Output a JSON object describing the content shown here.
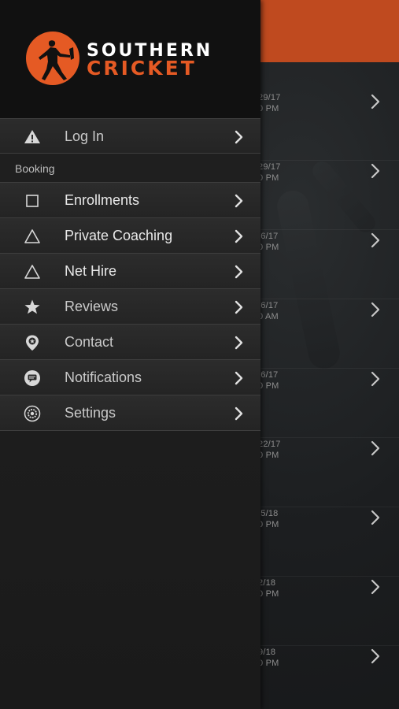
{
  "app": {
    "logo_line1": "SOUTHERN",
    "logo_line2": "CRICKET",
    "colors": {
      "accent": "#bf4a1f",
      "logo_orange": "#e55a24",
      "drawer_bg": "#242424",
      "header_bg": "#111111"
    }
  },
  "background_list": {
    "items": [
      {
        "date": "29/17",
        "time": "0 PM"
      },
      {
        "date": "29/17",
        "time": "0 PM"
      },
      {
        "date": "/6/17",
        "time": "0 PM"
      },
      {
        "date": "/6/17",
        "time": "0 AM"
      },
      {
        "date": "/6/17",
        "time": "0 PM"
      },
      {
        "date": "22/17",
        "time": "0 PM"
      },
      {
        "date": "/5/18",
        "time": "0 PM"
      },
      {
        "date": "2/18",
        "time": "0 PM"
      },
      {
        "date": "9/18",
        "time": "0 PM"
      }
    ]
  },
  "menu": {
    "login": {
      "label": "Log In",
      "icon": "warning-icon"
    },
    "section_booking": "Booking",
    "items": [
      {
        "label": "Enrollments",
        "icon": "square-icon"
      },
      {
        "label": "Private Coaching",
        "icon": "triangle-icon"
      },
      {
        "label": "Net Hire",
        "icon": "triangle-icon"
      },
      {
        "label": "Reviews",
        "icon": "star-icon"
      },
      {
        "label": "Contact",
        "icon": "location-pin-icon"
      },
      {
        "label": "Notifications",
        "icon": "speech-bubble-icon"
      },
      {
        "label": "Settings",
        "icon": "gear-icon"
      }
    ]
  }
}
